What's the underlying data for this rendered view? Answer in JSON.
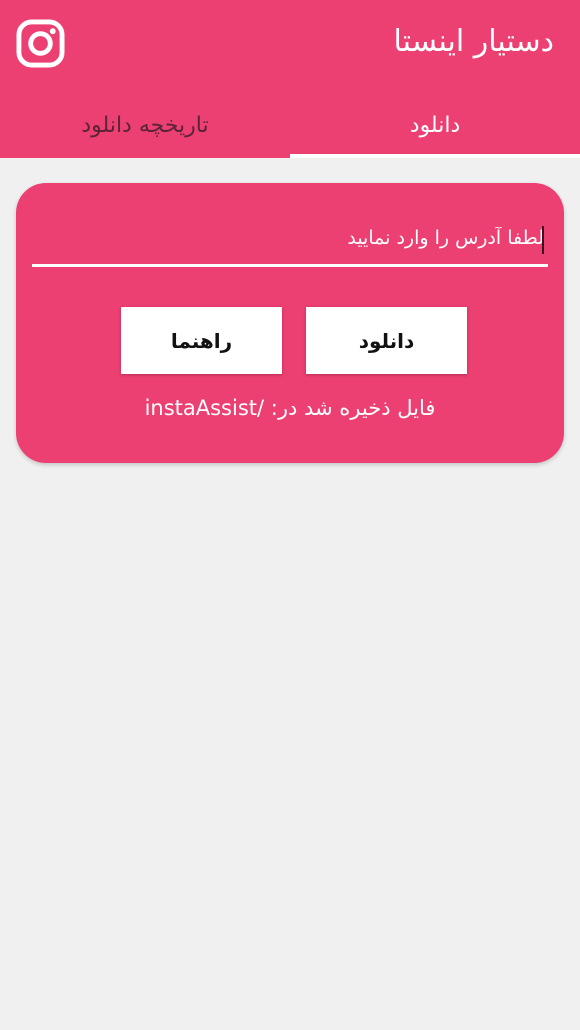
{
  "app": {
    "title": "دستیار اینستا",
    "logo_icon": "instagram-icon",
    "accent_color": "#ec3f72"
  },
  "tabs": [
    {
      "label": "تاریخچه دانلود",
      "active": false
    },
    {
      "label": "دانلود",
      "active": true
    }
  ],
  "download_card": {
    "url_value": "",
    "url_placeholder": "لطفا آدرس را وارد نمایید",
    "download_button": "دانلود",
    "guide_button": "راهنما",
    "save_path_text": "فایل ذخیره شد در: /instaAssist"
  }
}
